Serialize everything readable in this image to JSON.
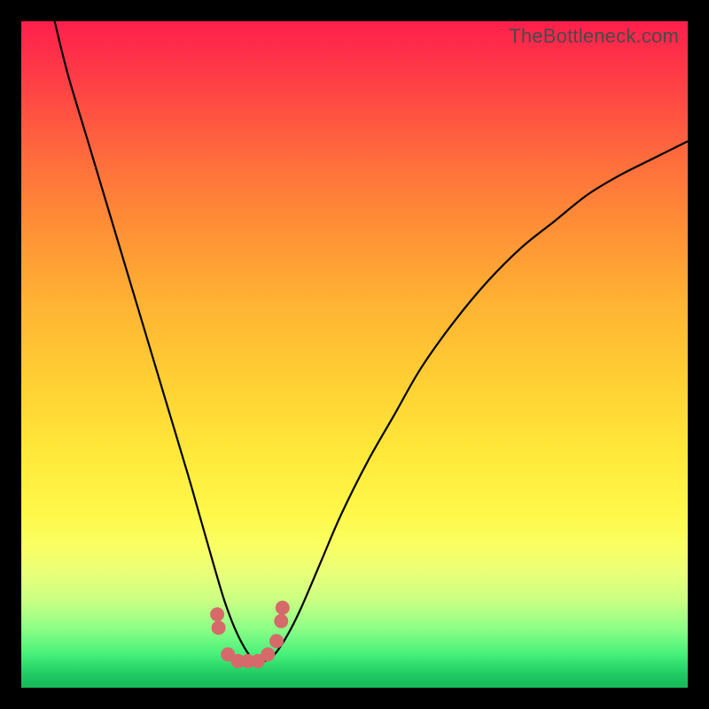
{
  "watermark": "TheBottleneck.com",
  "chart_data": {
    "type": "line",
    "title": "",
    "xlabel": "",
    "ylabel": "",
    "xlim": [
      0,
      100
    ],
    "ylim": [
      0,
      100
    ],
    "grid": false,
    "series": [
      {
        "name": "curve",
        "color": "#000000",
        "x": [
          5,
          7,
          10,
          13,
          16,
          19,
          22,
          25,
          27,
          29,
          30.5,
          32,
          33.5,
          35,
          36.5,
          38,
          40,
          42,
          45,
          48,
          52,
          56,
          60,
          65,
          70,
          75,
          80,
          85,
          90,
          95,
          100
        ],
        "y": [
          100,
          92,
          82,
          72,
          62,
          52,
          42,
          32,
          25,
          18,
          13,
          9,
          6,
          4,
          4,
          5,
          8,
          12,
          19,
          26,
          34,
          41,
          48,
          55,
          61,
          66,
          70,
          74,
          77,
          79.5,
          82
        ]
      },
      {
        "name": "dots",
        "color": "#d66a6a",
        "type": "scatter",
        "x": [
          29.4,
          29.6,
          31,
          32.5,
          34,
          35.5,
          37,
          38.3,
          39,
          39.2
        ],
        "y": [
          11,
          9,
          5,
          4,
          4,
          4,
          5,
          7,
          10,
          12
        ]
      }
    ]
  }
}
